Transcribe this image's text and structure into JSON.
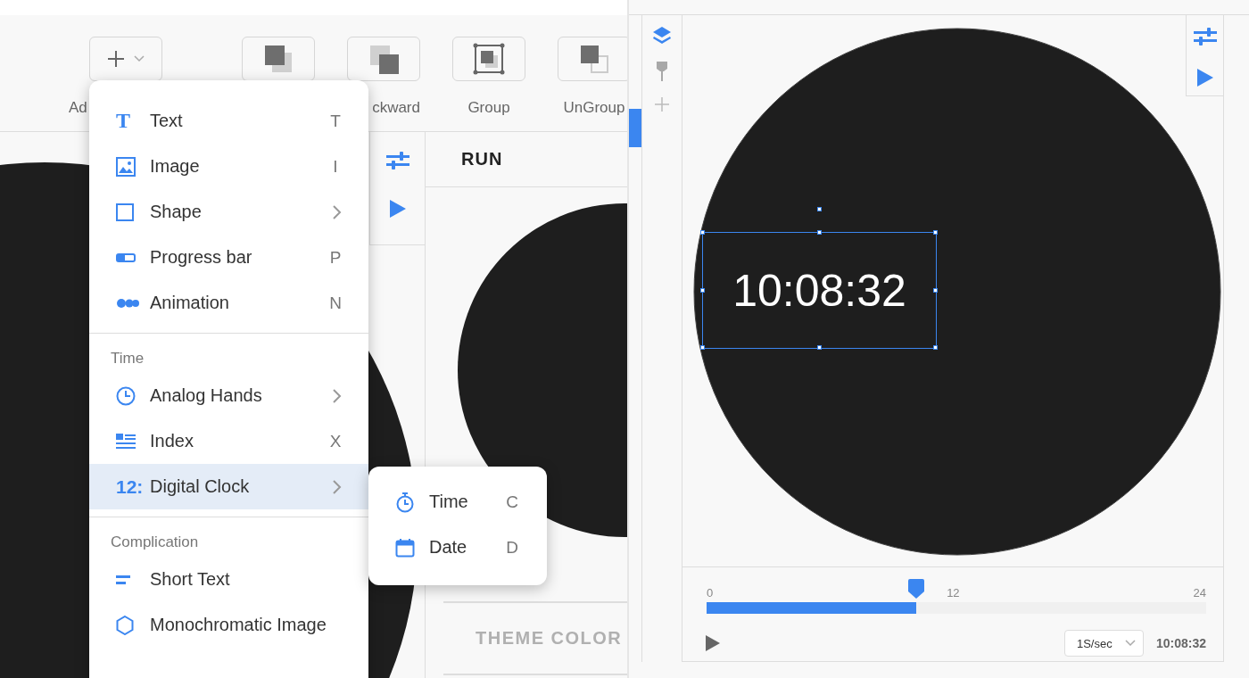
{
  "toolbar": {
    "tools": [
      {
        "kind": "add",
        "label": "Ad"
      },
      {
        "kind": "forward"
      },
      {
        "kind": "backward",
        "label": "ckward"
      },
      {
        "kind": "group",
        "label": "Group"
      },
      {
        "kind": "ungroup",
        "label": "UnGroup"
      }
    ]
  },
  "add_menu": {
    "sections": [
      {
        "items": [
          {
            "kind": "text",
            "icon_text": "T",
            "label": "Text",
            "shortcut": "T",
            "selected": false
          },
          {
            "kind": "image",
            "label": "Image",
            "shortcut": "I",
            "selected": false
          },
          {
            "kind": "shape",
            "label": "Shape",
            "has_submenu": true,
            "selected": false
          },
          {
            "kind": "progress",
            "label": "Progress bar",
            "shortcut": "P",
            "selected": false
          },
          {
            "kind": "animation",
            "label": "Animation",
            "shortcut": "N",
            "selected": false
          }
        ]
      },
      {
        "header": "Time",
        "items": [
          {
            "kind": "hands",
            "label": "Analog Hands",
            "has_submenu": true,
            "selected": false
          },
          {
            "kind": "index",
            "label": "Index",
            "shortcut": "X",
            "selected": false
          },
          {
            "kind": "digital",
            "icon_text": "12:",
            "label": "Digital Clock",
            "has_submenu": true,
            "selected": true
          }
        ]
      },
      {
        "header": "Complication",
        "items": [
          {
            "kind": "short",
            "label": "Short Text",
            "selected": false
          },
          {
            "kind": "mono",
            "label": "Monochromatic Image",
            "selected": false
          }
        ]
      }
    ]
  },
  "submenu": {
    "items": [
      {
        "kind": "timer",
        "label": "Time",
        "shortcut": "C"
      },
      {
        "kind": "date",
        "label": "Date",
        "shortcut": "D"
      }
    ]
  },
  "side_panel": {
    "header": "RUN",
    "section": "THEME COLOR"
  },
  "editor": {
    "clock_text": "10:08:32",
    "timeline": {
      "ticks": [
        "0",
        "12",
        "24"
      ],
      "level": 0.42
    },
    "speed": "1S/sec",
    "time": "10:08:32"
  }
}
